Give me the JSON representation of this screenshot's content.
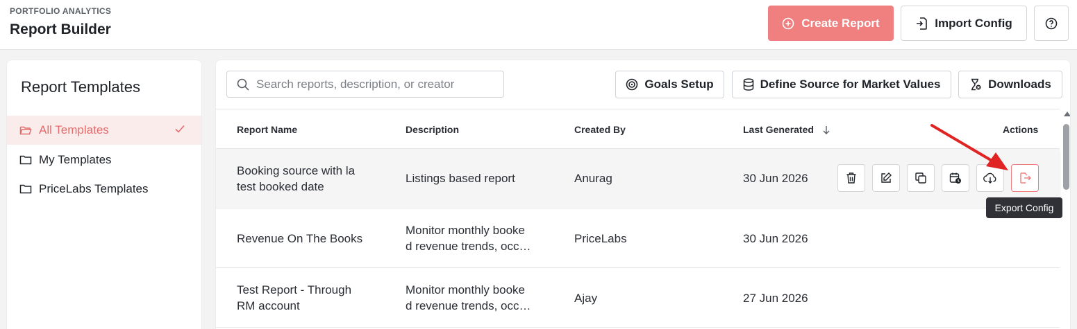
{
  "header": {
    "eyebrow": "PORTFOLIO ANALYTICS",
    "title": "Report Builder",
    "create_label": "Create Report",
    "import_label": "Import Config"
  },
  "sidebar": {
    "title": "Report Templates",
    "items": [
      {
        "label": "All Templates",
        "active": true
      },
      {
        "label": "My Templates"
      },
      {
        "label": "PriceLabs Templates"
      }
    ]
  },
  "toolbar": {
    "search_placeholder": "Search reports, description, or creator",
    "goals_label": "Goals Setup",
    "source_label": "Define Source for Market Values",
    "downloads_label": "Downloads"
  },
  "table": {
    "columns": [
      "Report Name",
      "Description",
      "Created By",
      "Last Generated",
      "Actions"
    ],
    "rows": [
      {
        "name": [
          "Booking source with la",
          "test booked date"
        ],
        "desc": [
          "Listings based report"
        ],
        "by": "Anurag",
        "date": "30 Jun 2026"
      },
      {
        "name": [
          "Revenue On The Books"
        ],
        "desc": [
          "Monitor monthly booke",
          "d revenue trends, occ…"
        ],
        "by": "PriceLabs",
        "date": "30 Jun 2026"
      },
      {
        "name": [
          "Test Report - Through",
          "RM account"
        ],
        "desc": [
          "Monitor monthly booke",
          "d revenue trends, occ…"
        ],
        "by": "Ajay",
        "date": "27 Jun 2026"
      }
    ]
  },
  "tooltip": "Export Config",
  "colors": {
    "accent": "#f08080",
    "active_bg": "#fbecec",
    "annotation_arrow": "#e02424"
  }
}
